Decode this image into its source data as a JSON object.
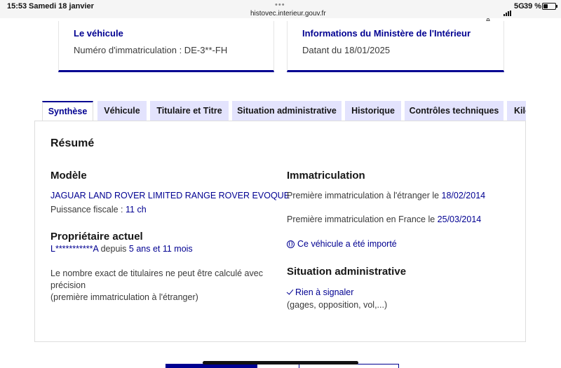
{
  "status": {
    "time": "15:53",
    "date": "Samedi 18 janvier",
    "url": "histovec.interieur.gouv.fr",
    "network": "5G",
    "battery": "39 %",
    "battery_level": 0.39
  },
  "cards": {
    "vehicle_title": "Le véhicule",
    "vehicle_text": "Numéro d'immatriculation : DE-3**-FH",
    "ministry_title": "Informations du Ministère de l'Intérieur",
    "ministry_text": "Datant du 18/01/2025"
  },
  "tabs": [
    "Synthèse",
    "Véhicule",
    "Titulaire et Titre",
    "Situation administrative",
    "Historique",
    "Contrôles techniques",
    "Kilo"
  ],
  "summary": {
    "heading": "Résumé",
    "model": {
      "heading": "Modèle",
      "name": "JAGUAR LAND ROVER LIMITED RANGE ROVER EVOQUE",
      "power_label": "Puissance fiscale : ",
      "power_value": "11 ch"
    },
    "owner": {
      "heading": "Propriétaire actuel",
      "name": "L***********A",
      "since_label": " depuis ",
      "since_value": "5 ans et 11 mois",
      "note_line1": "Le nombre exact de titulaires ne peut être calculé avec",
      "note_line2": "précision",
      "note_line3": "(première immatriculation à l'étranger)"
    },
    "registration": {
      "heading": "Immatriculation",
      "foreign_label": "Première immatriculation à l'étranger le ",
      "foreign_date": "18/02/2014",
      "france_label": "Première immatriculation en France le ",
      "france_date": "25/03/2014",
      "imported_link": "Ce véhicule a été importé"
    },
    "admin": {
      "heading": "Situation administrative",
      "status_link": "Rien à signaler",
      "details": "(gages, opposition, vol,...)"
    }
  }
}
